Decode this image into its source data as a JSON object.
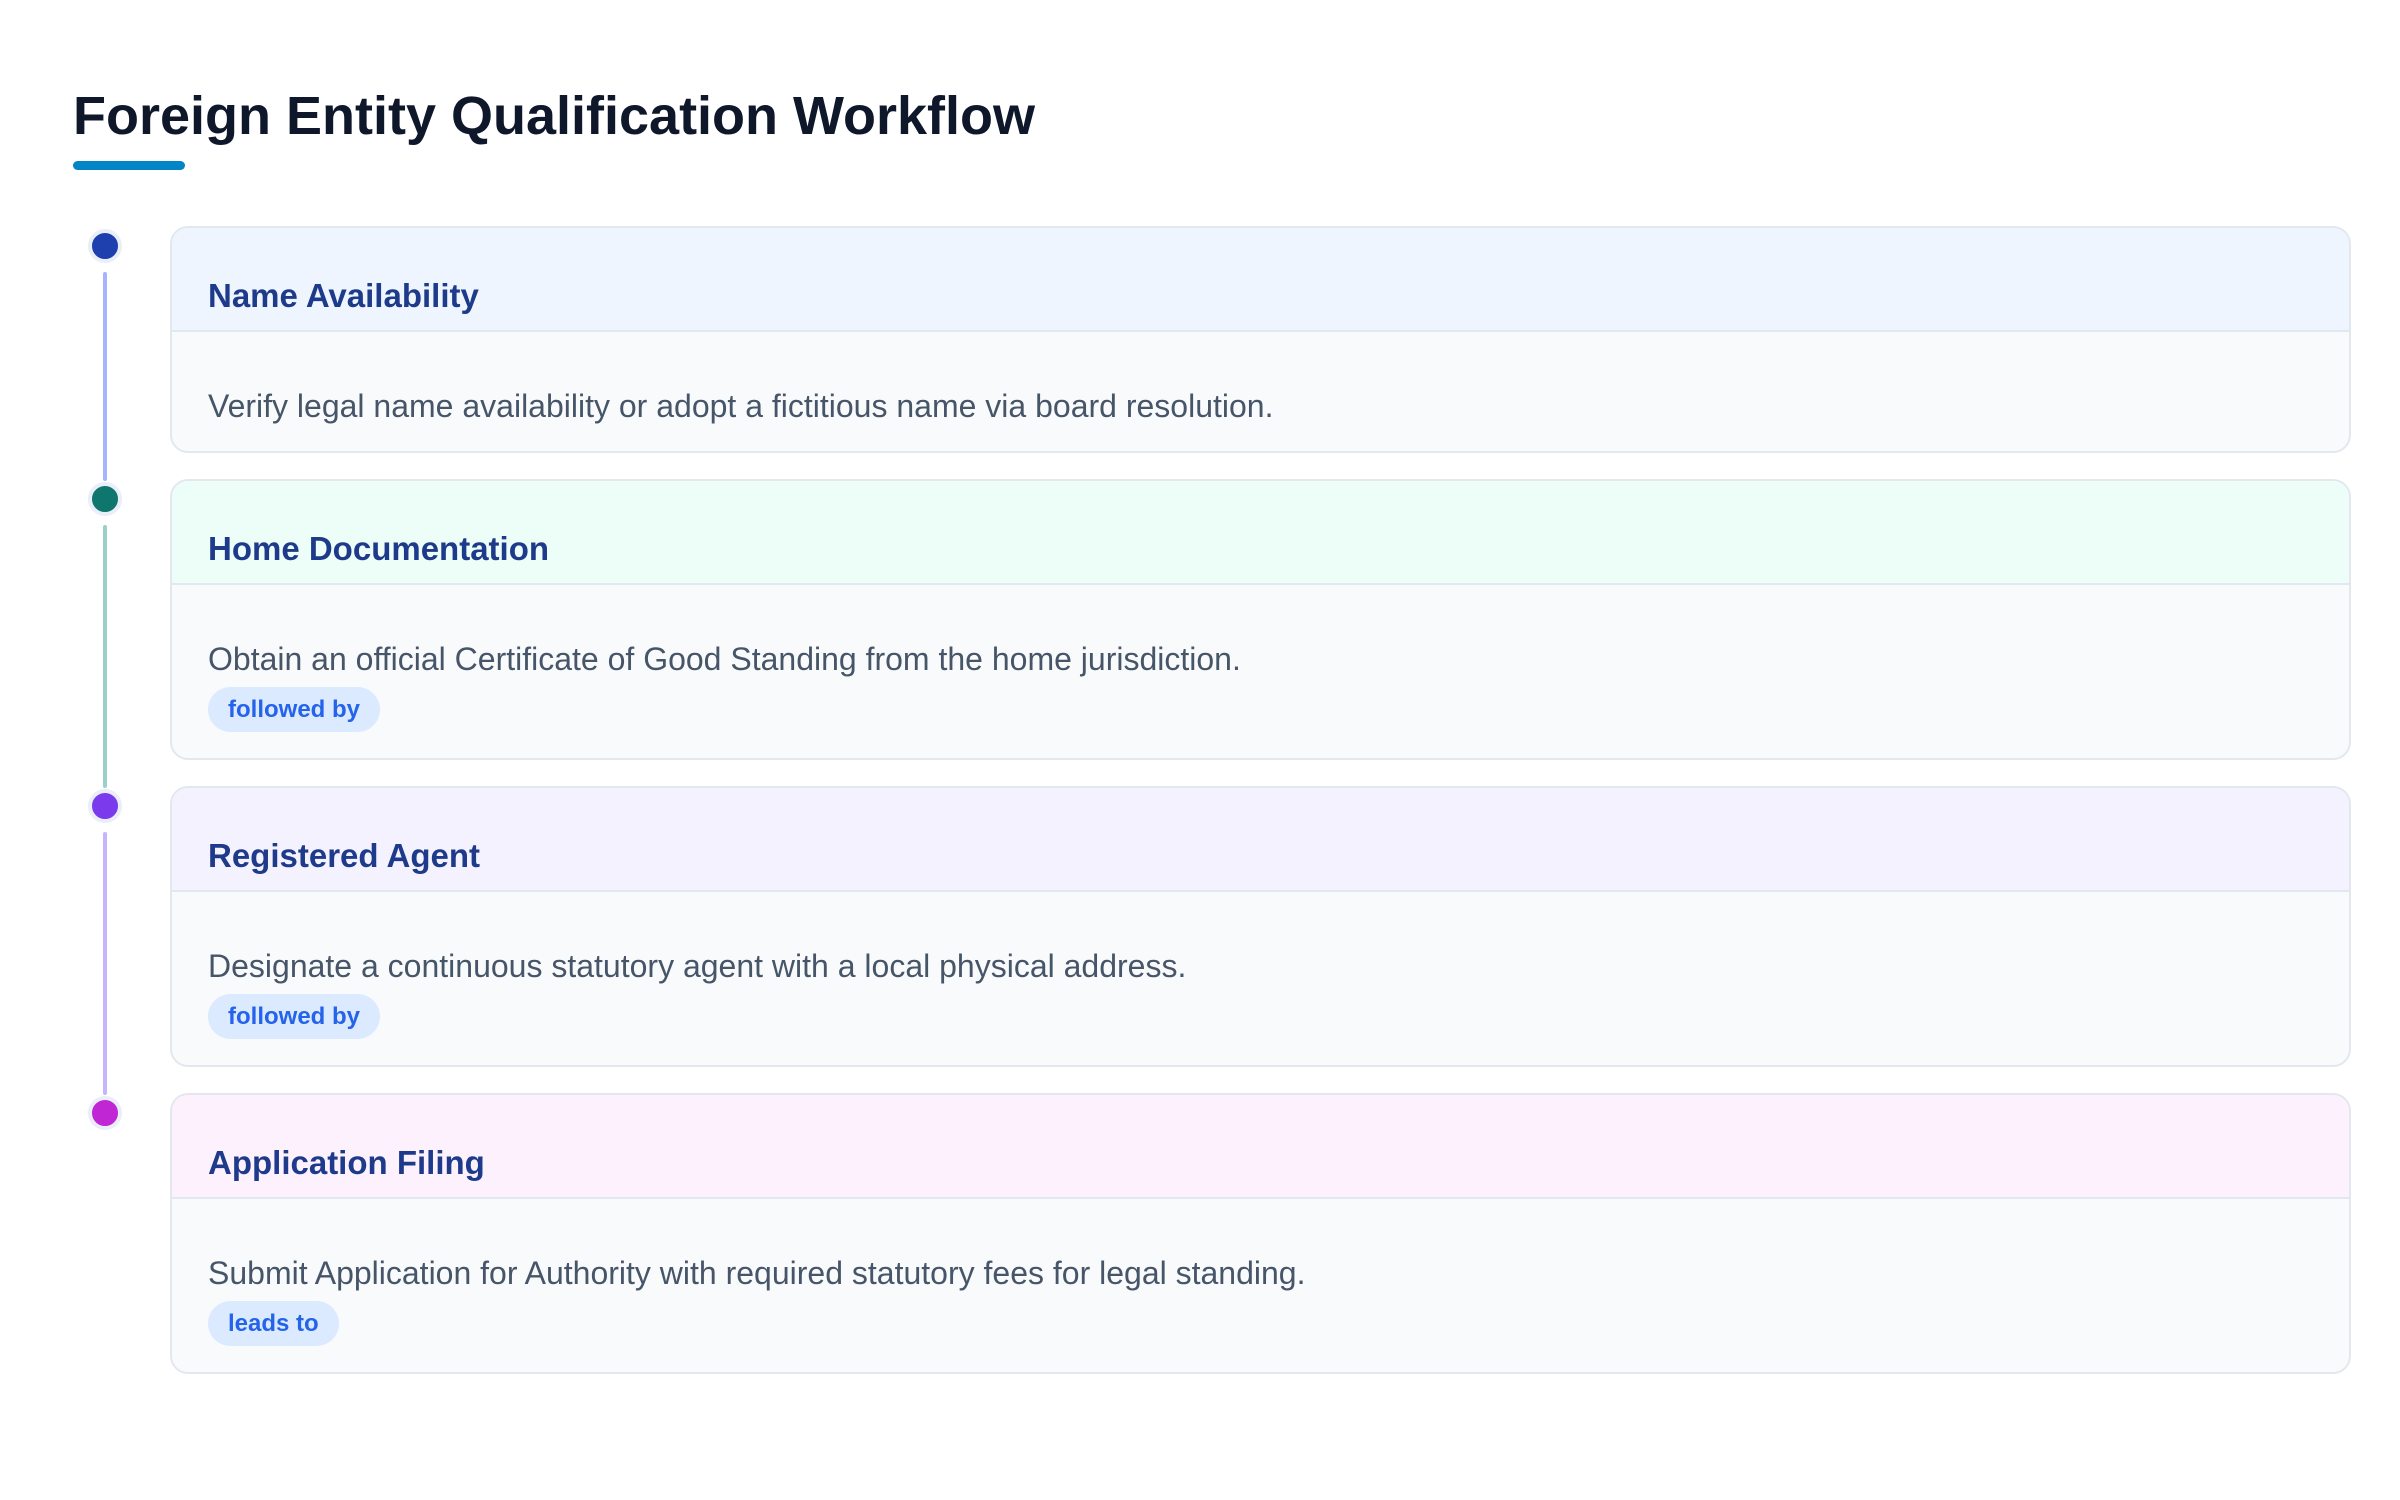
{
  "title": "Foreign Entity Qualification Workflow",
  "colors": {
    "accent": "#0284c7",
    "step_title": "#1e3a8a",
    "tag_bg": "#dbeafe",
    "tag_text": "#2563eb"
  },
  "steps": [
    {
      "title": "Name Availability",
      "description": "Verify legal name availability or adopt a fictitious name via board resolution.",
      "relation": null,
      "dot_color": "#1e40af",
      "line_color": "#a5b4fc",
      "header_bg": "#eef5ff"
    },
    {
      "title": "Home Documentation",
      "description": "Obtain an official Certificate of Good Standing from the home jurisdiction.",
      "relation": "followed by",
      "dot_color": "#0f766e",
      "line_color": "#99d1c8",
      "header_bg": "#edfdf8"
    },
    {
      "title": "Registered Agent",
      "description": "Designate a continuous statutory agent with a local physical address.",
      "relation": "followed by",
      "dot_color": "#7c3aed",
      "line_color": "#c4b5fd",
      "header_bg": "#f4f2fe"
    },
    {
      "title": "Application Filing",
      "description": "Submit Application for Authority with required statutory fees for legal standing.",
      "relation": "leads to",
      "dot_color": "#c026d3",
      "line_color": null,
      "header_bg": "#fdf1fd"
    }
  ]
}
